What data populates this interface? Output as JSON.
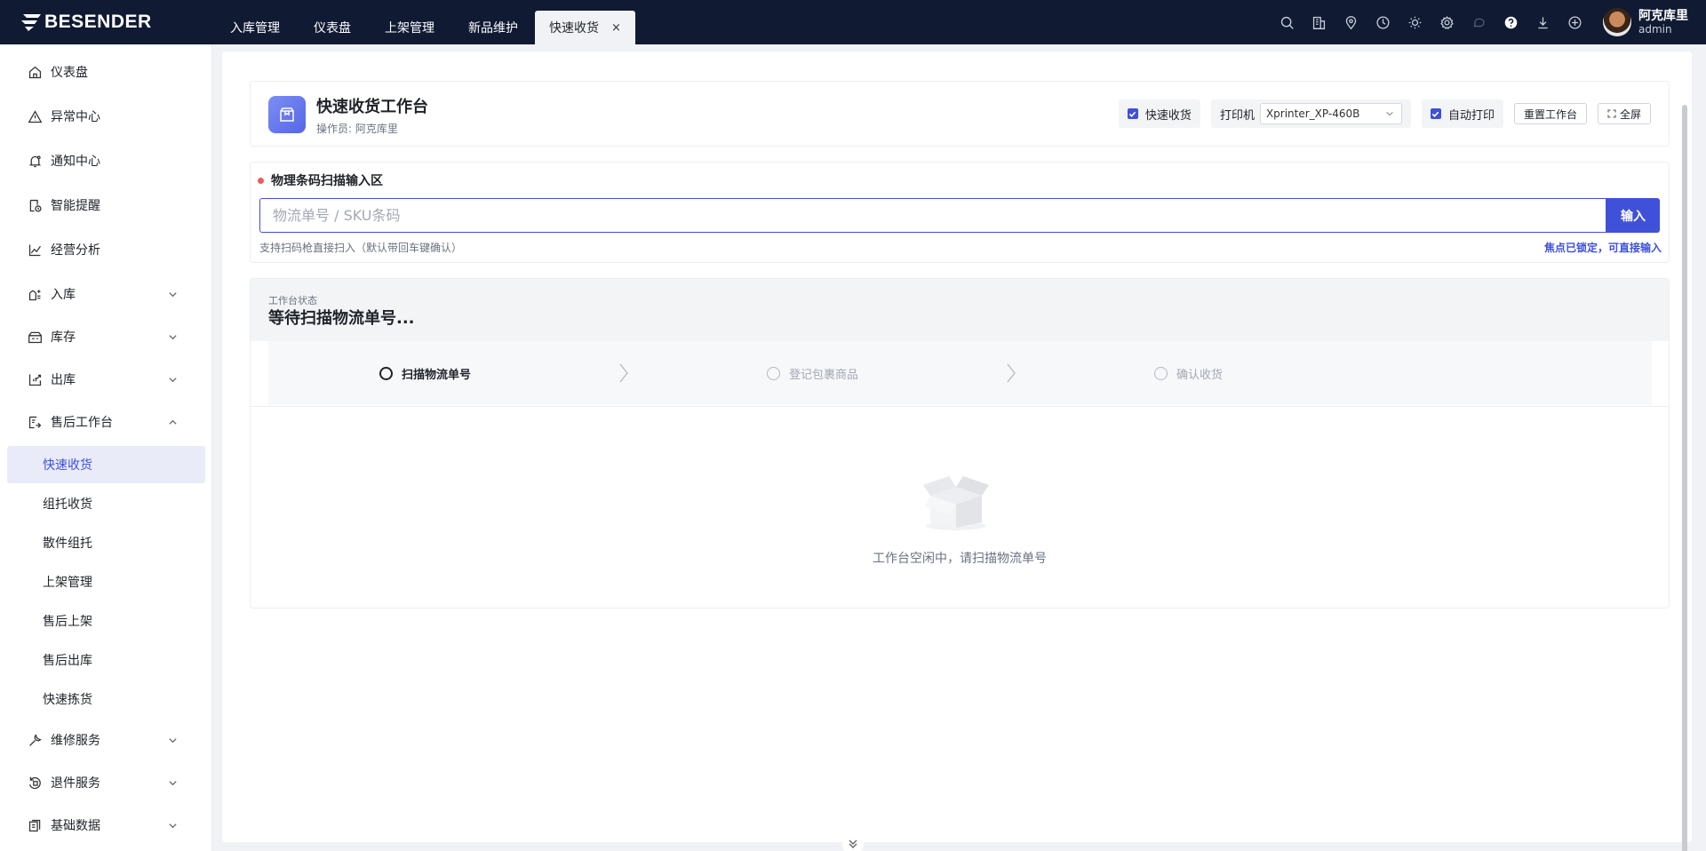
{
  "brand": {
    "name": "BESENDER"
  },
  "topnav": {
    "tabs": [
      {
        "label": "入库管理"
      },
      {
        "label": "仪表盘"
      },
      {
        "label": "上架管理"
      },
      {
        "label": "新品维护"
      }
    ],
    "active_tab": {
      "label": "快速收货",
      "close": "×"
    }
  },
  "toolbar_icons": [
    "search-icon",
    "building-icon",
    "location-icon",
    "clock-icon",
    "sun-icon",
    "gear-icon",
    "chat-icon",
    "help-icon",
    "download-icon",
    "plus-circle-icon"
  ],
  "user": {
    "name": "阿克库里",
    "role": "admin"
  },
  "sidebar": {
    "items": [
      {
        "label": "仪表盘",
        "icon": "home-icon"
      },
      {
        "label": "异常中心",
        "icon": "warning-icon"
      },
      {
        "label": "通知中心",
        "icon": "bell-icon"
      },
      {
        "label": "智能提醒",
        "icon": "reminder-icon"
      },
      {
        "label": "经营分析",
        "icon": "chart-icon"
      },
      {
        "label": "入库",
        "icon": "inbound-icon"
      },
      {
        "label": "库存",
        "icon": "warehouse-icon"
      },
      {
        "label": "出库",
        "icon": "outbound-icon"
      },
      {
        "label": "售后工作台",
        "icon": "aftersales-icon"
      },
      {
        "label": "维修服务",
        "icon": "wrench-icon"
      },
      {
        "label": "退件服务",
        "icon": "return-icon"
      },
      {
        "label": "基础数据",
        "icon": "database-icon"
      }
    ],
    "subitems": [
      {
        "label": "快速收货",
        "active": true
      },
      {
        "label": "组托收货"
      },
      {
        "label": "散件组托"
      },
      {
        "label": "上架管理"
      },
      {
        "label": "售后上架"
      },
      {
        "label": "售后出库"
      },
      {
        "label": "快速拣货"
      }
    ]
  },
  "header": {
    "title": "快速收货工作台",
    "operator": "操作员: 阿克库里",
    "quick_receive_label": "快速收货",
    "quick_receive_checked": true,
    "printer_label": "打印机",
    "printer_value": "Xprinter_XP-460B",
    "auto_print_label": "自动打印",
    "auto_print_checked": true,
    "reset_label": "重置工作台",
    "fullscreen_label": "全屏"
  },
  "scan": {
    "title": "物理条码扫描输入区",
    "placeholder": "物流单号 / SKU条码",
    "button": "输入",
    "hint": "支持扫码枪直接扫入（默认带回车键确认）",
    "focus_hint": "焦点已锁定，可直接输入"
  },
  "status": {
    "label": "工作台状态",
    "text": "等待扫描物流单号...",
    "steps": [
      {
        "label": "扫描物流单号",
        "active": true
      },
      {
        "label": "登记包裹商品"
      },
      {
        "label": "确认收货"
      }
    ],
    "empty_text": "工作台空闲中，请扫描物流单号"
  }
}
